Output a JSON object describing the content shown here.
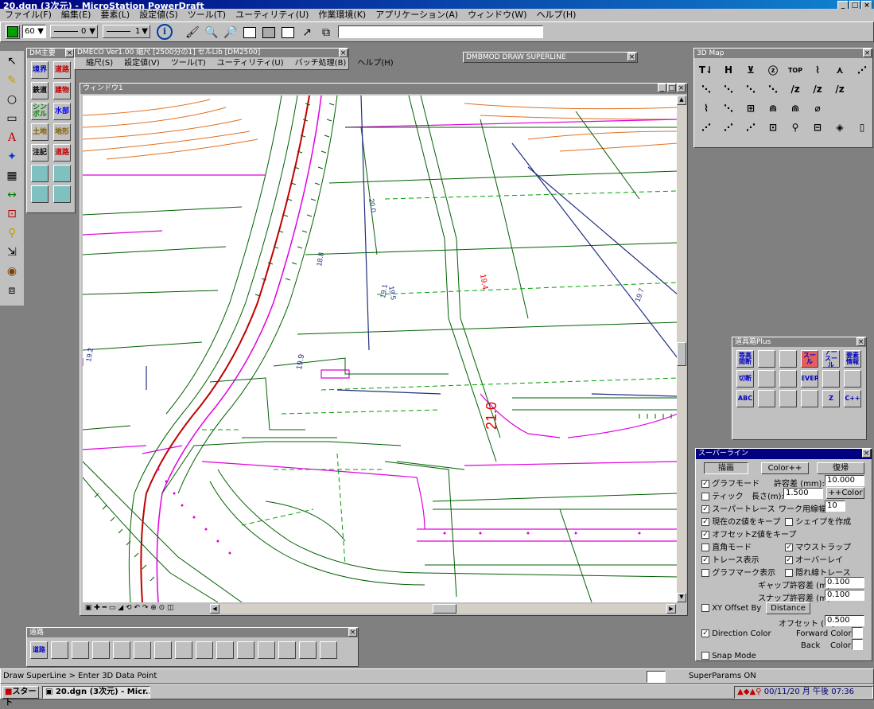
{
  "app": {
    "title": "20.dgn (3次元) - MicroStation PowerDraft",
    "menu": [
      "ファイル(F)",
      "編集(E)",
      "要素(L)",
      "設定値(S)",
      "ツール(T)",
      "ユーティリティ(U)",
      "作業環境(K)",
      "アプリケーション(A)",
      "ウィンドウ(W)",
      "ヘルプ(H)"
    ]
  },
  "attrbar": {
    "level": "60",
    "style": "0",
    "weight": "1"
  },
  "dm_palette": {
    "title": "DM主要",
    "tools": [
      {
        "label": "境界",
        "color": "#0000c0"
      },
      {
        "label": "道路",
        "color": "#c00000"
      },
      {
        "label": "鉄道",
        "color": "#000000"
      },
      {
        "label": "建物",
        "color": "#c00000"
      },
      {
        "label": "シンボル",
        "color": "#008000"
      },
      {
        "label": "水部",
        "color": "#0000ff"
      },
      {
        "label": "土地",
        "color": "#806000"
      },
      {
        "label": "地形",
        "color": "#806000"
      },
      {
        "label": "注記",
        "color": "#000000"
      },
      {
        "label": "道路",
        "color": "#c00000"
      },
      {
        "label": "",
        "color": "#008080"
      },
      {
        "label": "",
        "color": "#008080"
      },
      {
        "label": "",
        "color": "#408040"
      },
      {
        "label": "",
        "color": "#408040"
      }
    ]
  },
  "dmeco": {
    "title": "DMECO Ver1.00 縮尺 [2500分の1] セルLib [DM2500]",
    "menu": [
      "縮尺(S)",
      "設定値(V)",
      "ツール(T)",
      "ユーティリティ(U)",
      "バッチ処理(B)",
      "ヘルプ(H)"
    ]
  },
  "mdl_box": {
    "title": "DMBMOD DRAW SUPERLINE"
  },
  "view_window": {
    "title": "ウィンドウ1",
    "annotations": [
      "21.0",
      "19.4",
      "19.9",
      "20.0",
      "19.7",
      "19.5",
      "19.2",
      "19.1",
      "18.8"
    ]
  },
  "map3d": {
    "title": "3D Map",
    "tool_count": 32,
    "top_label": "TOP"
  },
  "dogu_plus": {
    "title": "道具箱Plus",
    "tools": [
      "等高間断",
      "",
      "",
      "スール",
      "アースール",
      "要素情報",
      "切断",
      "",
      "",
      "REVERS",
      "",
      "",
      "ABC",
      "",
      "",
      "",
      "Z",
      "C++"
    ]
  },
  "superline": {
    "title": "スーパーライン",
    "draw_button": "描画",
    "color_button": "Color++",
    "reset_button": "復帰",
    "graph_mode": "グラフモード",
    "tolerance_label": "許容差 (mm):",
    "tolerance_value": "10.000",
    "tick": "ティック",
    "length_label": "長さ(m):",
    "length_value": "1.500",
    "pluscolor_button": "++Color",
    "super_trace": "スーパートレース",
    "work_width_label": "ワーク用線幅:",
    "work_width_value": "10",
    "keep_z": "現在のZ値をキープ",
    "make_shape": "シェイプを作成",
    "offset_z": "オフセットZ値をキープ",
    "right_angle": "直角モード",
    "mouse_trap": "マウストラップ",
    "trace_display": "トレース表示",
    "overlay": "オーバーレイ",
    "graph_mark": "グラフマーク表示",
    "hidden_trace": "隠れ線トレース",
    "gap_label": "ギャップ許容差 (m):",
    "gap_value": "0.100",
    "snap_label": "スナップ許容差 (m):",
    "snap_value": "0.100",
    "xy_offset": "XY Offset By",
    "distance_button": "Distance",
    "offset_label": "オフセット (m):",
    "offset_value": "0.500",
    "direction_color": "Direction Color",
    "forward_color": "Forward Color:",
    "back_color": "Back    Color:",
    "snap_mode": "Snap Mode"
  },
  "road_palette": {
    "title": "道路",
    "tools": [
      "道路",
      "",
      "",
      "",
      "",
      "",
      "",
      "",
      "",
      "",
      "",
      "",
      "",
      "",
      ""
    ]
  },
  "status": {
    "prompt": "Draw SuperLine > Enter 3D Data Point",
    "message": "SuperParams ON"
  },
  "taskbar": {
    "start": "スタート",
    "task": "20.dgn (3次元) - Micr...",
    "clock": "00/11/20 月 午後 07:36"
  },
  "colors": {
    "accent": "#000080",
    "pink": "#e000e0",
    "green": "#006000",
    "orange": "#e07020"
  }
}
